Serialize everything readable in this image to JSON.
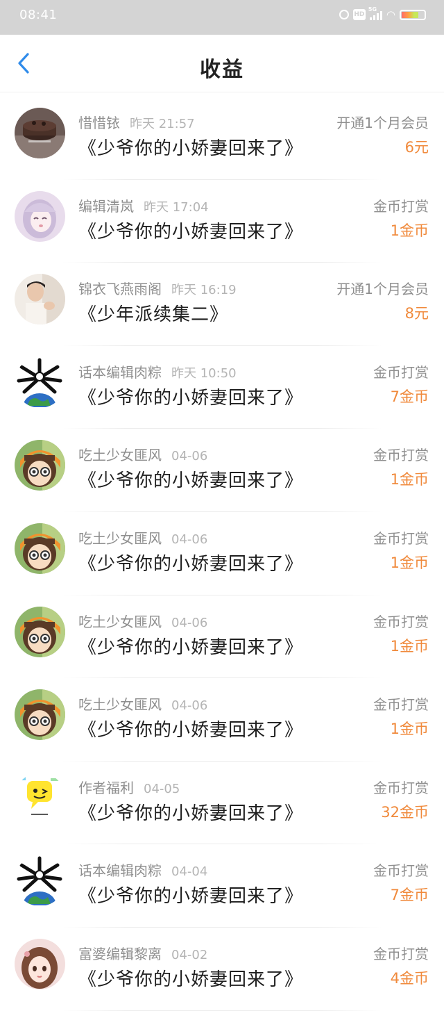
{
  "status_bar": {
    "time": "08:41",
    "network": "5G",
    "hd_label": "HD"
  },
  "header": {
    "title": "收益",
    "back_icon": "chevron-left-icon",
    "accent_color": "#2f8bea"
  },
  "colors": {
    "amount": "#f08a3c",
    "muted": "#8f8f8f"
  },
  "records": [
    {
      "user": "惜惜铱",
      "time": "昨天 21:57",
      "book": "《少爷你的小娇妻回来了》",
      "type": "开通1个月会员",
      "amount": "6元",
      "avatar": "cake"
    },
    {
      "user": "编辑清岚",
      "time": "昨天 17:04",
      "book": "《少爷你的小娇妻回来了》",
      "type": "金币打赏",
      "amount": "1金币",
      "avatar": "anime-girl-lilac"
    },
    {
      "user": "锦衣飞燕雨阁",
      "time": "昨天 16:19",
      "book": "《少年派续集二》",
      "type": "开通1个月会员",
      "amount": "8元",
      "avatar": "photo-boy"
    },
    {
      "user": "话本编辑肉粽",
      "time": "昨天 10:50",
      "book": "《少爷你的小娇妻回来了》",
      "type": "金币打赏",
      "amount": "7金币",
      "avatar": "globe-bones"
    },
    {
      "user": "吃土少女匪风",
      "time": "04-06",
      "book": "《少爷你的小娇妻回来了》",
      "type": "金币打赏",
      "amount": "1金币",
      "avatar": "glasses-girl"
    },
    {
      "user": "吃土少女匪风",
      "time": "04-06",
      "book": "《少爷你的小娇妻回来了》",
      "type": "金币打赏",
      "amount": "1金币",
      "avatar": "glasses-girl"
    },
    {
      "user": "吃土少女匪风",
      "time": "04-06",
      "book": "《少爷你的小娇妻回来了》",
      "type": "金币打赏",
      "amount": "1金币",
      "avatar": "glasses-girl"
    },
    {
      "user": "吃土少女匪风",
      "time": "04-06",
      "book": "《少爷你的小娇妻回来了》",
      "type": "金币打赏",
      "amount": "1金币",
      "avatar": "glasses-girl"
    },
    {
      "user": "作者福利",
      "time": "04-05",
      "book": "《少爷你的小娇妻回来了》",
      "type": "金币打赏",
      "amount": "32金币",
      "avatar": "yellow-chat"
    },
    {
      "user": "话本编辑肉粽",
      "time": "04-04",
      "book": "《少爷你的小娇妻回来了》",
      "type": "金币打赏",
      "amount": "7金币",
      "avatar": "globe-bones"
    },
    {
      "user": "富婆编辑黎离",
      "time": "04-02",
      "book": "《少爷你的小娇妻回来了》",
      "type": "金币打赏",
      "amount": "4金币",
      "avatar": "anime-girl-brown"
    }
  ]
}
